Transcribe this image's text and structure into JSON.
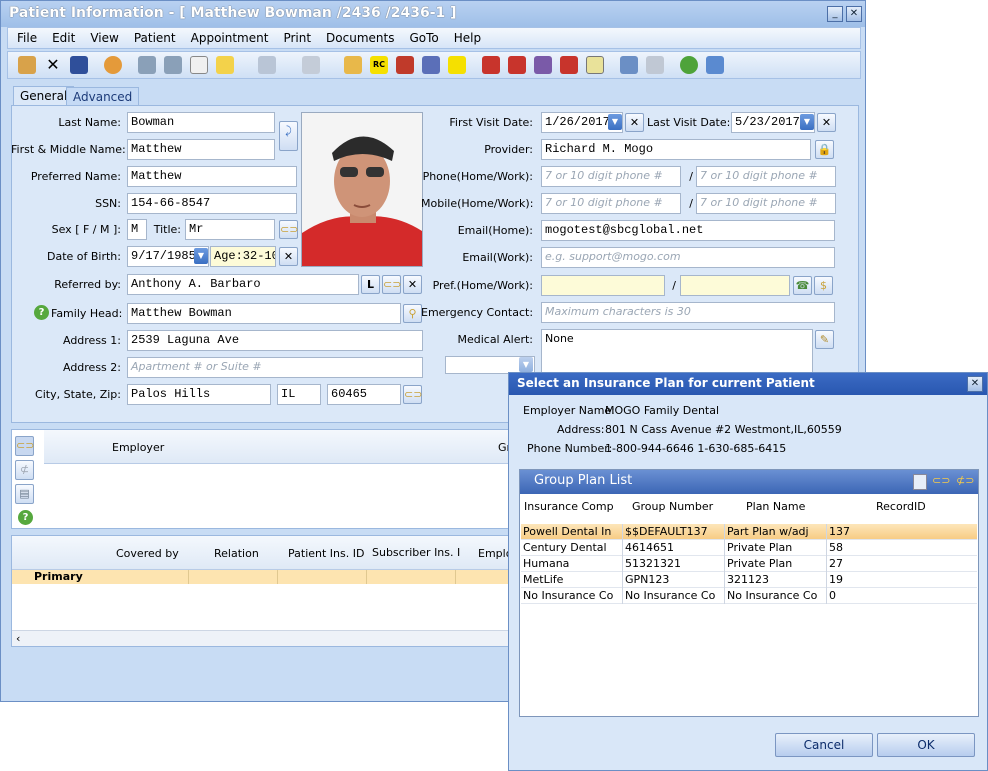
{
  "window": {
    "title": "Patient Information - [ Matthew Bowman /2436 /2436-1 ]"
  },
  "menu": [
    "File",
    "Edit",
    "View",
    "Patient",
    "Appointment",
    "Print",
    "Documents",
    "GoTo",
    "Help"
  ],
  "tabs": {
    "general": "General",
    "advanced": "Advanced"
  },
  "form": {
    "last_name_label": "Last Name:",
    "last_name": "Bowman",
    "first_name_label": "First & Middle Name:",
    "first_name": "Matthew",
    "preferred_label": "Preferred Name:",
    "preferred": "Matthew",
    "ssn_label": "SSN:",
    "ssn": "154-66-8547",
    "sex_label": "Sex [ F / M ]:",
    "sex": "M",
    "title_label": "Title:",
    "title": "Mr",
    "dob_label": "Date of Birth:",
    "dob": "9/17/1985",
    "age": "Age:32-10",
    "referred_label": "Referred by:",
    "referred": "Anthony A. Barbaro",
    "referred_btn": "L",
    "family_label": "Family Head:",
    "family": "Matthew Bowman",
    "addr1_label": "Address 1:",
    "addr1": "2539 Laguna Ave",
    "addr2_label": "Address 2:",
    "addr2_ph": "Apartment # or Suite #",
    "csz_label": "City, State, Zip:",
    "city": "Palos Hills",
    "state": "IL",
    "zip": "60465",
    "first_visit_label": "First Visit Date:",
    "first_visit": "1/26/2017",
    "last_visit_label": "Last Visit Date:",
    "last_visit": "5/23/2017",
    "provider_label": "Provider:",
    "provider": "Richard M. Mogo",
    "phone_label": "Phone(Home/Work):",
    "phone_ph": "7 or 10 digit phone #",
    "mobile_label": "Mobile(Home/Work):",
    "slash": "/",
    "email_home_label": "Email(Home):",
    "email_home": "mogotest@sbcglobal.net",
    "email_work_label": "Email(Work):",
    "email_work_ph": "e.g. support@mogo.com",
    "pref_label": "Pref.(Home/Work):",
    "emergency_label": "Emergency Contact:",
    "emergency_ph": "Maximum characters is 30",
    "alert_label": "Medical Alert:",
    "alert": "None"
  },
  "grid1": {
    "employer": "Employer",
    "partial": "Gr"
  },
  "grid2": {
    "covered_by": "Covered by",
    "relation": "Relation",
    "patient_ins": "Patient Ins. ID",
    "subscriber_ins": "Subscriber Ins. I",
    "employer_partial": "Emplo",
    "primary": "Primary"
  },
  "dialog": {
    "title": "Select an Insurance Plan for current Patient",
    "employer_label": "Employer Name:",
    "employer": "MOGO Family Dental",
    "address_label": "Address:",
    "address": "801 N Cass Avenue #2  Westmont,IL,60559",
    "phone_label": "Phone Number:",
    "phone": "1-800-944-6646  1-630-685-6415",
    "list_title": "Group Plan List",
    "columns": [
      "Insurance Comp",
      "Group Number",
      "Plan Name",
      "RecordID"
    ],
    "rows": [
      [
        "Powell Dental In",
        "$$DEFAULT137",
        "Part Plan w/adj",
        "137"
      ],
      [
        "Century Dental",
        "4614651",
        "Private Plan",
        "58"
      ],
      [
        "Humana",
        "51321321",
        "Private Plan",
        "27"
      ],
      [
        "MetLife",
        "GPN123",
        "321123",
        "19"
      ],
      [
        "No Insurance Co",
        "No Insurance Co",
        "No Insurance Co",
        "0"
      ]
    ],
    "cancel": "Cancel",
    "ok": "OK"
  }
}
